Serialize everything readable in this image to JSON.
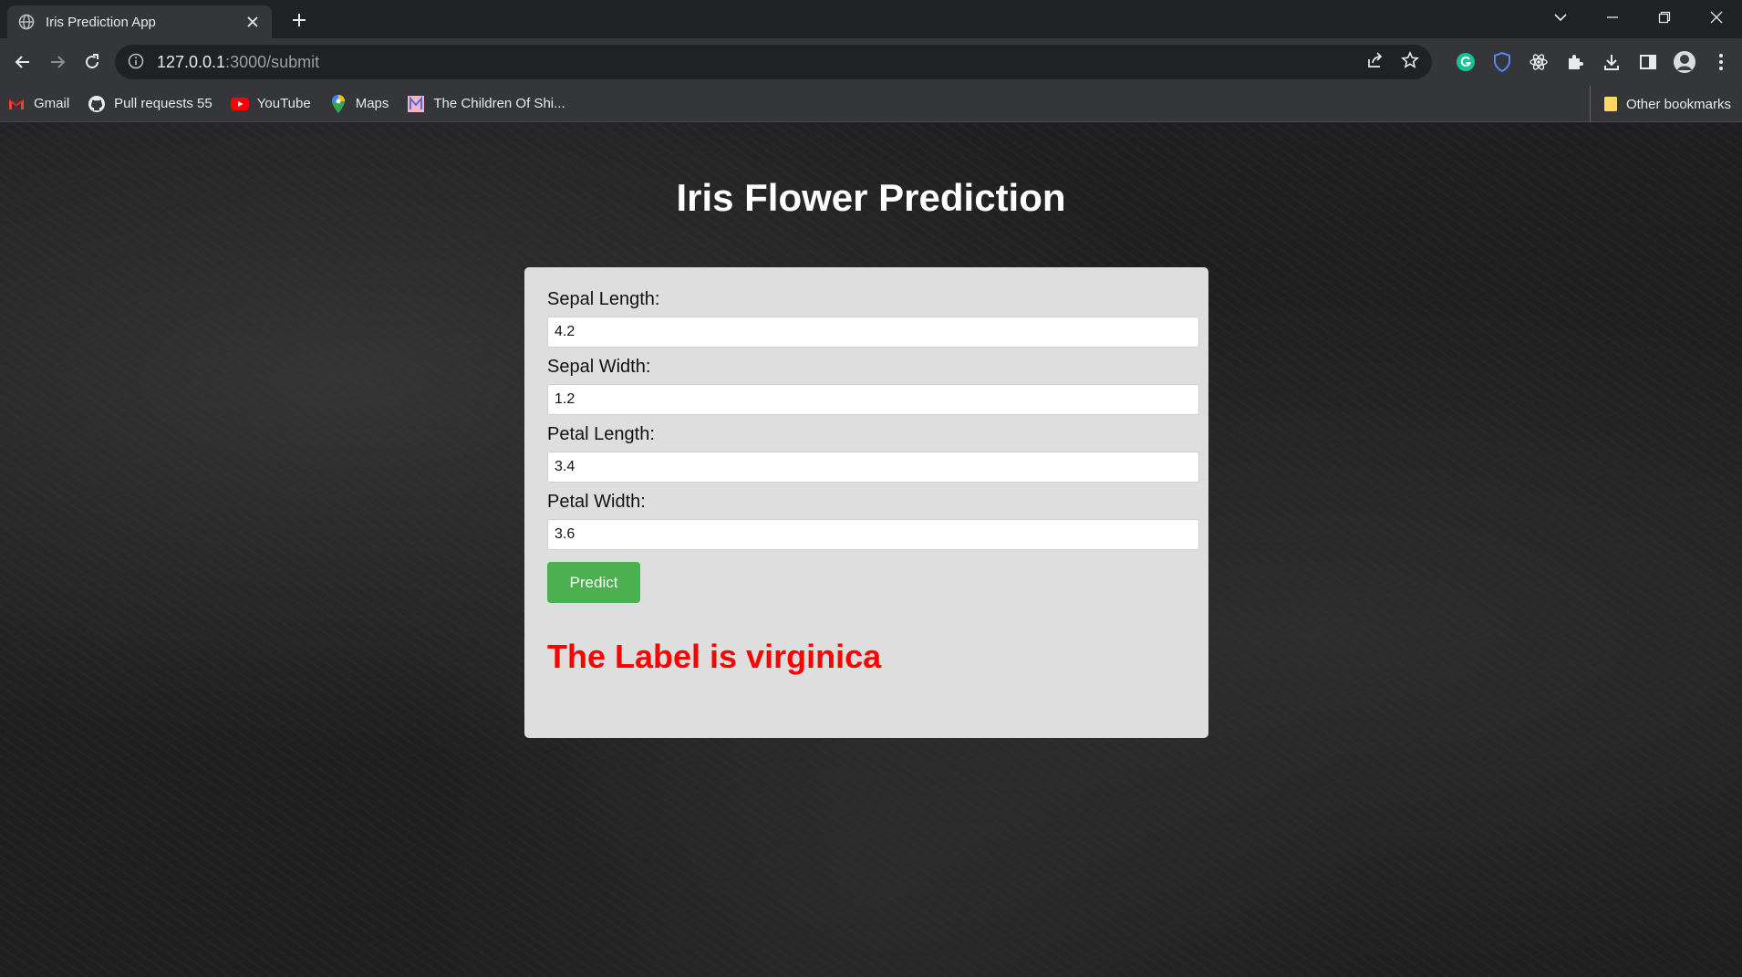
{
  "browser": {
    "tab_title": "Iris Prediction App",
    "url_host": "127.0.0.1",
    "url_path": ":3000/submit",
    "bookmarks": [
      {
        "label": "Gmail",
        "icon": "gmail-icon"
      },
      {
        "label": "Pull requests 55",
        "icon": "github-icon"
      },
      {
        "label": "YouTube",
        "icon": "youtube-icon"
      },
      {
        "label": "Maps",
        "icon": "maps-icon"
      },
      {
        "label": "The Children Of Shi...",
        "icon": "bookmark-site-icon"
      }
    ],
    "other_bookmarks": "Other bookmarks",
    "colors": {
      "chrome_dark": "#202124",
      "chrome_toolbar": "#35363a"
    }
  },
  "page": {
    "title": "Iris Flower Prediction",
    "fields": [
      {
        "label": "Sepal Length:",
        "value": "4.2"
      },
      {
        "label": "Sepal Width:",
        "value": "1.2"
      },
      {
        "label": "Petal Length:",
        "value": "3.4"
      },
      {
        "label": "Petal Width:",
        "value": "3.6"
      }
    ],
    "button_label": "Predict",
    "result": "The Label is virginica",
    "colors": {
      "button": "#4caf50",
      "result": "#ff0000",
      "card": "#dedede"
    }
  }
}
